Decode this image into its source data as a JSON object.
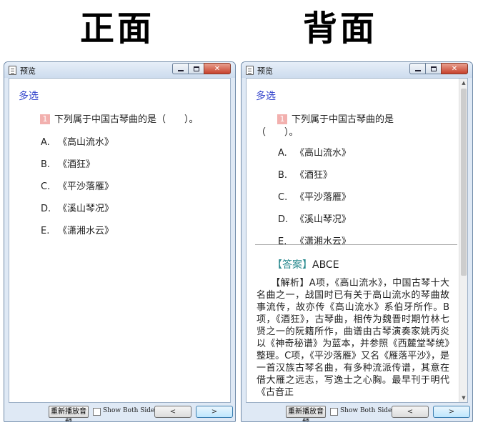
{
  "headings": {
    "front": "正面",
    "back": "背面"
  },
  "window": {
    "title": "预览"
  },
  "question": {
    "type": "多选",
    "number": "1",
    "stem": "下列属于中国古琴曲的是（　　）。",
    "stem_back_line1": "下列属于中国古琴曲的是",
    "stem_back_line2": "（　　）。",
    "options": [
      {
        "letter": "A.",
        "text": "《高山流水》"
      },
      {
        "letter": "B.",
        "text": "《酒狂》"
      },
      {
        "letter": "C.",
        "text": "《平沙落雁》"
      },
      {
        "letter": "D.",
        "text": "《溪山琴况》"
      },
      {
        "letter": "E.",
        "text": "《潇湘水云》"
      }
    ]
  },
  "answer": {
    "label": "【答案】",
    "value": "ABCE"
  },
  "analysis": {
    "label": "【解析】",
    "text": "A项，《高山流水》，中国古琴十大名曲之一，战国时已有关于高山流水的琴曲故事流传，故亦传《高山流水》系伯牙所作。B项，《酒狂》，古琴曲，相传为魏晋时期竹林七贤之一的阮籍所作，曲谱由古琴演奏家姚丙炎以《神奇秘谱》为蓝本，并参照《西麓堂琴统》整理。C项，《平沙落雁》又名《雁落平沙》，是一首汉族古琴名曲，有多种流派传谱，其意在借大雁之远志，写逸士之心胸。最早刊于明代《古音正"
  },
  "footer": {
    "replay_label": "重新播放音频",
    "show_both_label": "Show Both Sides",
    "prev_label": "<",
    "next_label": ">"
  },
  "icons": {
    "minimize": "minimize-icon",
    "maximize": "maximize-icon",
    "close": "close-icon",
    "scroll_up": "▲",
    "scroll_down": "▼",
    "close_glyph": "✕"
  }
}
